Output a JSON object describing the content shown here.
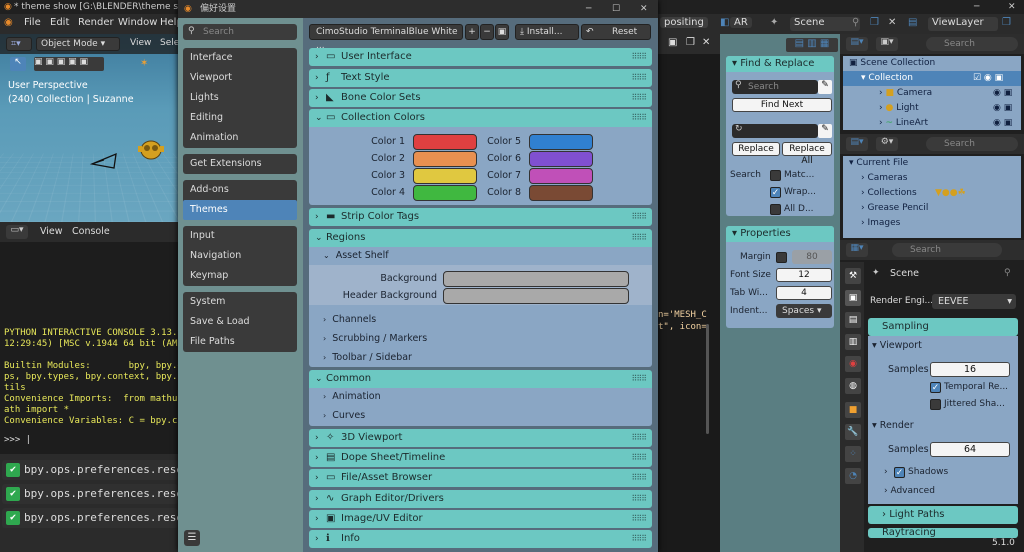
{
  "app": {
    "window_title": "* theme show [G:\\BLENDER\\theme show.blend]",
    "menus": [
      "File",
      "Edit",
      "Render",
      "Window",
      "Help"
    ],
    "tab_partial": "positing",
    "render_engine_short": "AR",
    "scene_name": "Scene",
    "view_layer": "ViewLayer",
    "version": "5.1.0",
    "accent_color": "#6cc8c2",
    "panel_color": "#8aa6c4"
  },
  "viewport": {
    "mode": "Object Mode",
    "view_menu": "View",
    "select_menu": "Sele",
    "perspective": "User Perspective",
    "collection_info": "(240) Collection | Suzanne"
  },
  "console": {
    "menu_view": "View",
    "menu_console": "Console",
    "lines": [
      "PYTHON INTERACTIVE CONSOLE 3.13.9",
      "12:29:45) [MSC v.1944 64 bit (AMD",
      "",
      "Builtin Modules:       bpy, bpy.da",
      "ps, bpy.types, bpy.context, bpy.u",
      "tils",
      "Convenience Imports:  from mathu",
      "ath import *",
      "Convenience Variables: C = bpy.co"
    ],
    "prompt": ">>> |"
  },
  "info_log": [
    "bpy.ops.preferences.reset",
    "bpy.ops.preferences.reset",
    "bpy.ops.preferences.reset"
  ],
  "prefs": {
    "title": "偏好设置",
    "search_placeholder": "Search",
    "nav_groups": [
      [
        "Interface",
        "Viewport",
        "Lights",
        "Editing",
        "Animation"
      ],
      [
        "Get Extensions"
      ],
      [
        "Add-ons",
        "Themes"
      ],
      [
        "Input",
        "Navigation",
        "Keymap"
      ],
      [
        "System",
        "Save & Load",
        "File Paths"
      ]
    ],
    "active_item": "Themes",
    "theme_preset": "CimoStudio TerminalBlue White ...",
    "install_label": "Install...",
    "reset_label": "Reset",
    "sections": {
      "user_interface": "User Interface",
      "text_style": "Text Style",
      "bone_color_sets": "Bone Color Sets",
      "collection_colors": "Collection Colors",
      "strip_color_tags": "Strip Color Tags",
      "regions": "Regions",
      "common": "Common",
      "viewport_3d": "3D Viewport",
      "dope_sheet": "Dope Sheet/Timeline",
      "file_browser": "File/Asset Browser",
      "graph_editor": "Graph Editor/Drivers",
      "image_editor": "Image/UV Editor",
      "info": "Info"
    },
    "collection_colors": [
      {
        "label": "Color 1",
        "color": "#e04040"
      },
      {
        "label": "Color 2",
        "color": "#e89050"
      },
      {
        "label": "Color 3",
        "color": "#e0c840"
      },
      {
        "label": "Color 4",
        "color": "#40b840"
      },
      {
        "label": "Color 5",
        "color": "#3080d0"
      },
      {
        "label": "Color 6",
        "color": "#8050d0"
      },
      {
        "label": "Color 7",
        "color": "#c050b8"
      },
      {
        "label": "Color 8",
        "color": "#7a4a34"
      }
    ],
    "regions": {
      "asset_shelf": "Asset Shelf",
      "background": "Background",
      "header_background": "Header Background",
      "channels": "Channels",
      "scrubbing": "Scrubbing / Markers",
      "toolbar_sidebar": "Toolbar / Sidebar"
    },
    "common": {
      "animation": "Animation",
      "curves": "Curves"
    }
  },
  "text_editor": {
    "snippet1": "n='MESH_C",
    "snippet2": "t\", icon="
  },
  "find_replace": {
    "title": "Find & Replace",
    "search_placeholder": "Search",
    "find_next": "Find Next",
    "replace": "Replace",
    "replace_all": "Replace All",
    "search_label": "Search",
    "opt_match": "Matc...",
    "opt_wrap": "Wrap...",
    "opt_all": "All D...",
    "properties_title": "Properties",
    "margin_label": "Margin",
    "margin_value": "80",
    "font_size_label": "Font Size",
    "font_size_value": "12",
    "tab_width_label": "Tab Wi...",
    "tab_width_value": "4",
    "indent_label": "Indent...",
    "indent_value": "Spaces"
  },
  "outliner": {
    "search_placeholder": "Search",
    "scene_collection": "Scene Collection",
    "rows": [
      "Collection",
      "Camera",
      "Light",
      "LineArt"
    ],
    "current_file": "Current File",
    "file_rows": [
      "Cameras",
      "Collections",
      "Grease Pencil",
      "Images"
    ]
  },
  "properties": {
    "search_placeholder": "Search",
    "scene": "Scene",
    "render_engine_label": "Render Engi...",
    "render_engine": "EEVEE",
    "sampling": "Sampling",
    "viewport": "Viewport",
    "samples_label": "Samples",
    "viewport_samples": "16",
    "temporal": "Temporal Re...",
    "jittered": "Jittered Sha...",
    "render": "Render",
    "render_samples": "64",
    "shadows": "Shadows",
    "advanced": "Advanced",
    "light_paths": "Light Paths",
    "raytracing": "Raytracing"
  }
}
